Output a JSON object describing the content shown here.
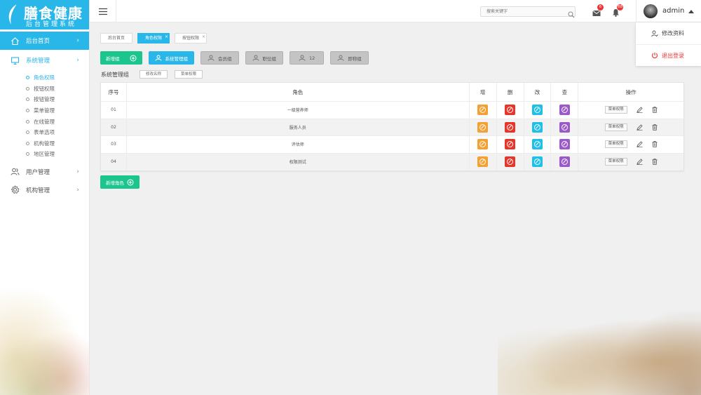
{
  "brand": {
    "title": "膳食健康",
    "subtitle": "后台管理系统"
  },
  "sidebar": {
    "items": [
      {
        "label": "后台首页",
        "icon": "home-icon",
        "arrow": "›"
      },
      {
        "label": "系统管理",
        "icon": "monitor-icon",
        "arrow": "›"
      },
      {
        "label": "用户管理",
        "icon": "users-icon",
        "arrow": "›"
      },
      {
        "label": "机构管理",
        "icon": "gear-icon",
        "arrow": "›"
      }
    ],
    "submenu": [
      "角色权限",
      "按钮权限",
      "按钮管理",
      "菜单管理",
      "在线管理",
      "表单选项",
      "机构管理",
      "地区管理"
    ]
  },
  "header": {
    "search_placeholder": "搜索关键字",
    "mail_count": "6",
    "bell_count": "88",
    "username": "admin"
  },
  "user_menu": {
    "edit_profile": "修改资料",
    "logout": "退出登录"
  },
  "tabs": [
    {
      "label": "后台首页",
      "close": ""
    },
    {
      "label": "角色权限",
      "close": "×"
    },
    {
      "label": "按钮权限",
      "close": "×"
    }
  ],
  "groups": {
    "add_group": "新增组",
    "items": [
      "系统管理组",
      "会员组",
      "职位组",
      "12",
      "即称组"
    ]
  },
  "current_group": {
    "title": "系统管理组",
    "rename": "修改名称",
    "menu_perm": "菜单权限"
  },
  "table": {
    "headers": [
      "序号",
      "角色",
      "增",
      "删",
      "改",
      "查",
      "操作"
    ],
    "rows": [
      {
        "no": "01",
        "role": "一级营养师",
        "perm": "菜单权限"
      },
      {
        "no": "02",
        "role": "服务人员",
        "perm": "菜单权限"
      },
      {
        "no": "03",
        "role": "评估师",
        "perm": "菜单权限"
      },
      {
        "no": "04",
        "role": "权限测试",
        "perm": "菜单权限"
      }
    ]
  },
  "add_role": "新增角色",
  "colors": {
    "accent": "#29b6e8",
    "green": "#1cc48e",
    "add": "#f5a033",
    "delete": "#e8352a",
    "edit": "#1ec0ea",
    "view": "#9b59c9",
    "logout": "#e33333"
  }
}
